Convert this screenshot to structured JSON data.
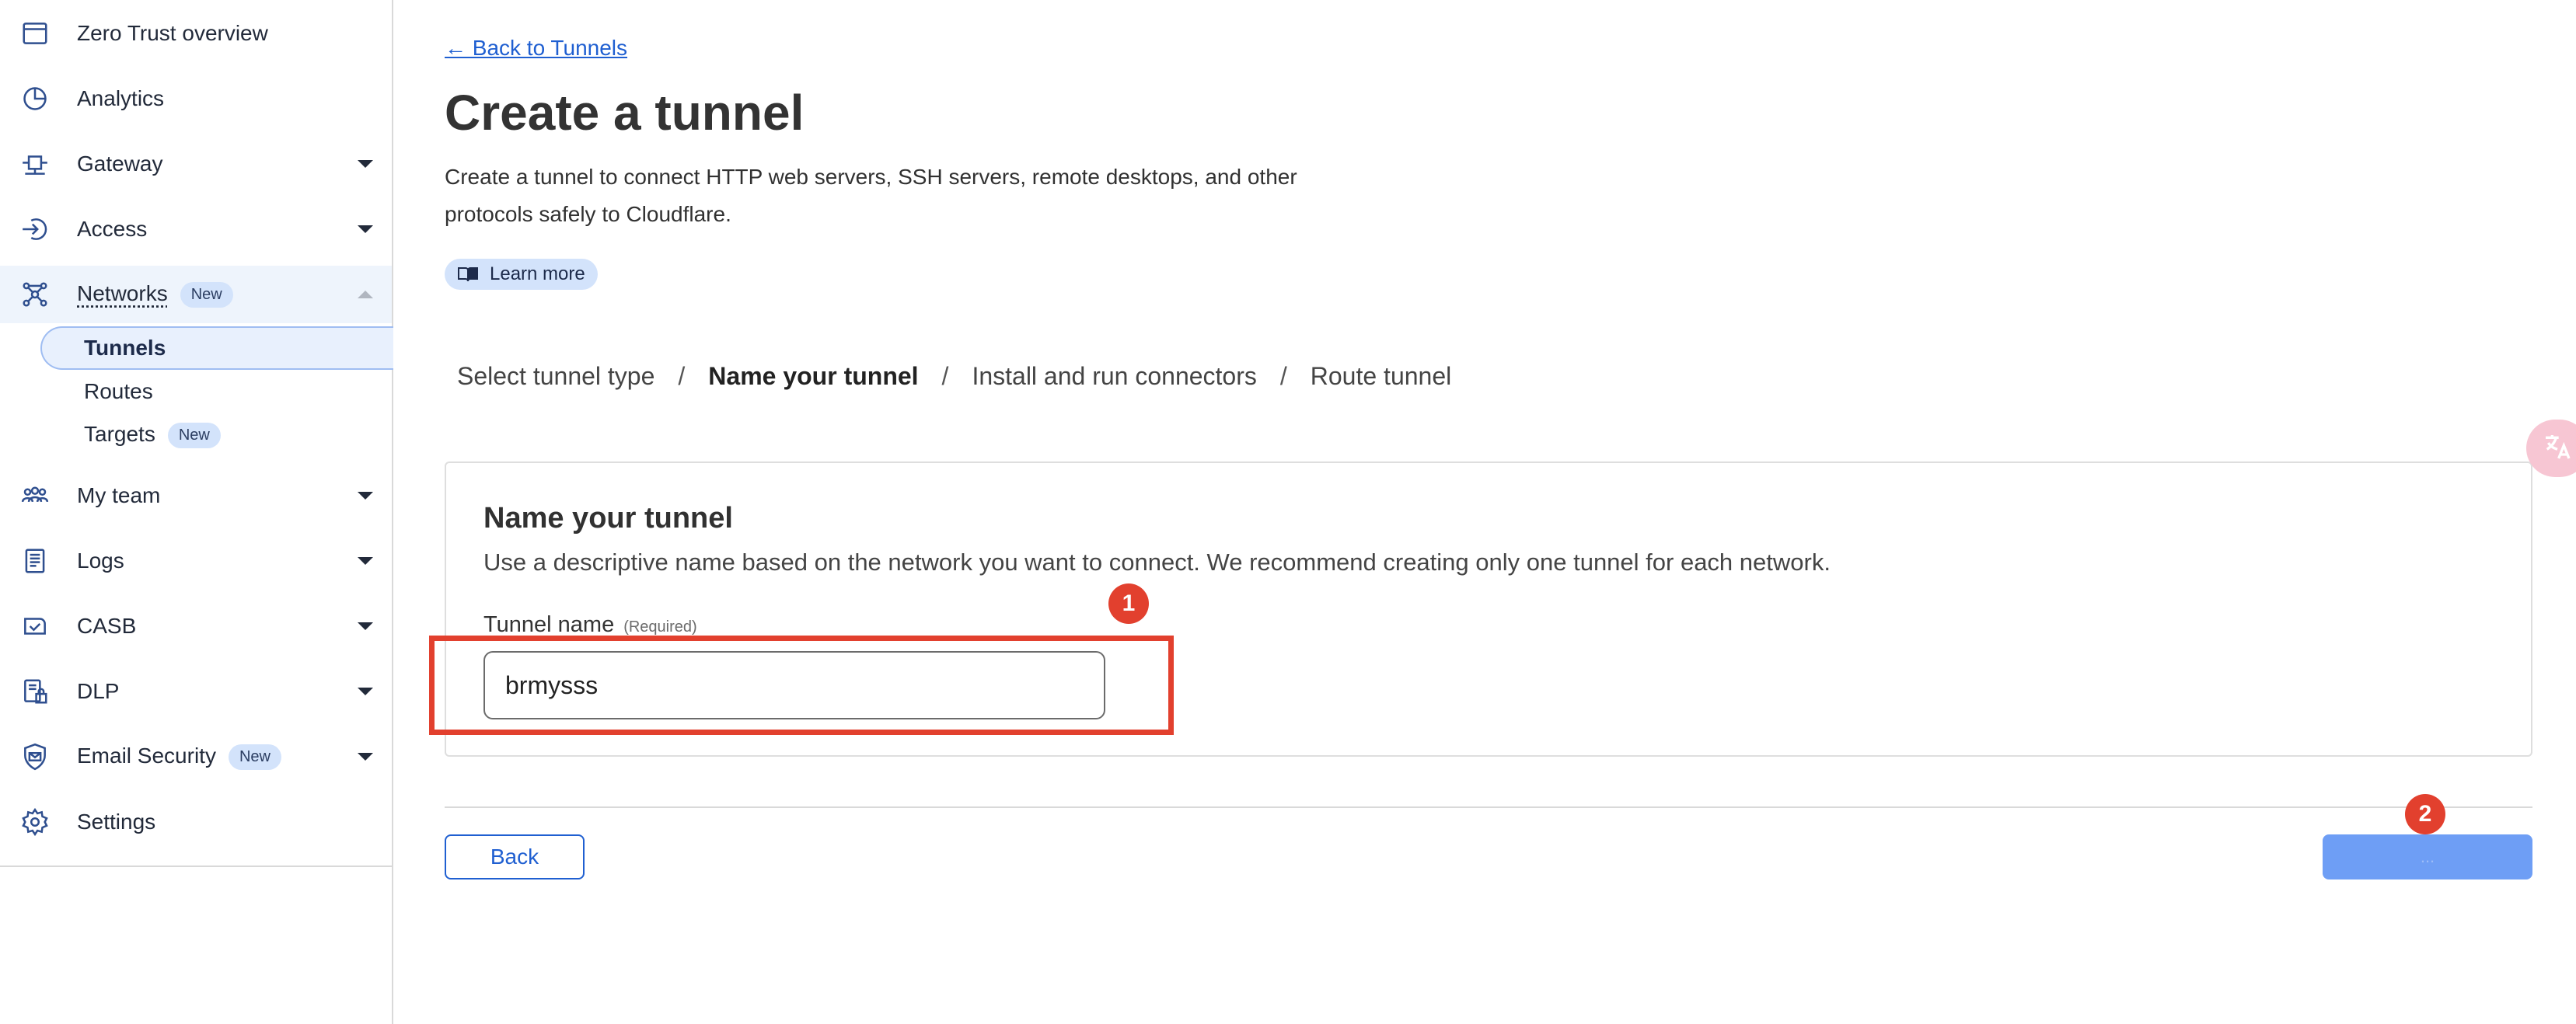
{
  "sidebar": {
    "items": [
      {
        "label": "Zero Trust overview",
        "icon": "browser-window-icon"
      },
      {
        "label": "Analytics",
        "icon": "pie-chart-icon"
      },
      {
        "label": "Gateway",
        "icon": "gateway-icon"
      },
      {
        "label": "Access",
        "icon": "access-login-icon"
      },
      {
        "label": "Networks",
        "icon": "network-nodes-icon",
        "badge": "New"
      },
      {
        "label": "My team",
        "icon": "team-users-icon"
      },
      {
        "label": "Logs",
        "icon": "logs-document-icon"
      },
      {
        "label": "CASB",
        "icon": "casb-check-icon"
      },
      {
        "label": "DLP",
        "icon": "dlp-lock-document-icon"
      },
      {
        "label": "Email Security",
        "icon": "email-shield-icon",
        "badge": "New"
      },
      {
        "label": "Settings",
        "icon": "gear-icon"
      }
    ],
    "networks_sub": [
      {
        "label": "Tunnels"
      },
      {
        "label": "Routes"
      },
      {
        "label": "Targets",
        "badge": "New"
      }
    ]
  },
  "main": {
    "back_link": "← Back to Tunnels",
    "title": "Create a tunnel",
    "description": "Create a tunnel to connect HTTP web servers, SSH servers, remote desktops, and other protocols safely to Cloudflare.",
    "learn_more": "Learn more",
    "steps": [
      "Select tunnel type",
      "Name your tunnel",
      "Install and run connectors",
      "Route tunnel"
    ],
    "step_separator": "/",
    "current_step": 1,
    "card": {
      "title": "Name your tunnel",
      "description": "Use a descriptive name based on the network you want to connect. We recommend creating only one tunnel for each network.",
      "field_label": "Tunnel name",
      "field_required": "(Required)",
      "field_value": "brmysss"
    },
    "back_button": "Back",
    "next_button": "..."
  },
  "annotations": {
    "marker_1": "1",
    "marker_2": "2"
  },
  "colors": {
    "accent": "#1f5fd1",
    "marker": "#e2402e",
    "badge_bg": "#d3e3fb",
    "primary_disabled": "#6e9ef5"
  }
}
